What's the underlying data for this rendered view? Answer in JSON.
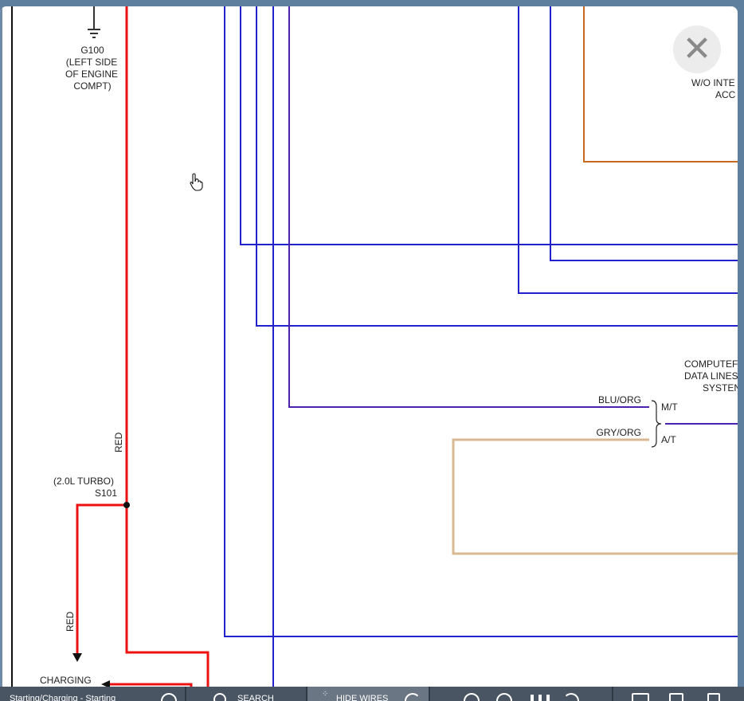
{
  "close_glyph": "✕",
  "diagram": {
    "ground": {
      "id": "G100",
      "line1": "(LEFT SIDE",
      "line2": "OF ENGINE",
      "line3": "COMPT)"
    },
    "wire_red_label": "RED",
    "wire_red_label_2": "RED",
    "splice": {
      "note": "(2.0L TURBO)",
      "id": "S101"
    },
    "charging": "CHARGING",
    "wo_label_1": "W/O INTE",
    "wo_label_2": "ACC",
    "computer_1": "COMPUTEF",
    "computer_2": "DATA LINES",
    "computer_3": "SYSTEN",
    "wire_blu_org": "BLU/ORG",
    "wire_gry_org": "GRY/ORG",
    "mt": "M/T",
    "at": "A/T",
    "colors": {
      "red": "#ee1111",
      "blue": "#2222cc",
      "purple": "#4b22b0",
      "tan": "#d8b890",
      "orange": "#c86a1e",
      "black": "#111111"
    }
  },
  "toolbar": {
    "starting_label": "Starting/Charging - Starting",
    "search_label": "SEARCH",
    "hide_wires_label": "HIDE WIRES"
  },
  "icons": [
    "close-icon",
    "hand-cursor-icon",
    "ground-symbol-icon",
    "zoom-icon",
    "search-icon",
    "hide-wires-icon",
    "undo-icon",
    "zoom-out-icon",
    "zoom-in-icon",
    "adjust-icon",
    "rotate-icon",
    "window-icon",
    "print-icon",
    "page-icon"
  ]
}
